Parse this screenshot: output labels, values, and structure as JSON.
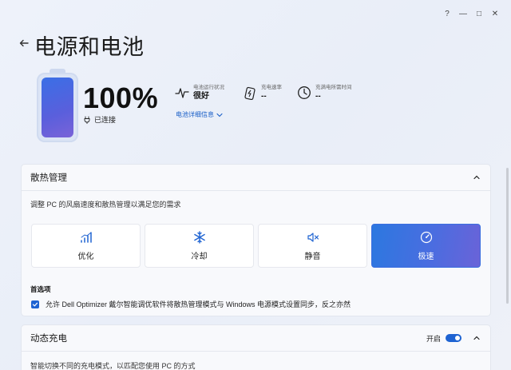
{
  "window": {
    "controls": {
      "help": "?",
      "minimize": "—",
      "maximize": "□",
      "close": "✕"
    }
  },
  "header": {
    "title": "电源和电池",
    "back_icon": "arrow-left-icon"
  },
  "battery": {
    "level_percent": 100,
    "percent_text": "100%",
    "status": "已连接",
    "fill_color": "#4a66e0"
  },
  "stats": [
    {
      "label": "电池运行状况",
      "value": "很好",
      "icon": "pulse-icon"
    },
    {
      "label": "充电速率",
      "value": "--",
      "icon": "battery-charging-icon"
    },
    {
      "label": "充满电所需时间",
      "value": "--",
      "icon": "clock-icon"
    }
  ],
  "detail_link": "电池详细信息",
  "thermal": {
    "title": "散热管理",
    "description": "调整 PC 的风扇速度和散热管理以满足您的需求",
    "modes": [
      {
        "label": "优化",
        "icon": "optimize-bars-icon",
        "active": false
      },
      {
        "label": "冷却",
        "icon": "snowflake-icon",
        "active": false
      },
      {
        "label": "静音",
        "icon": "mute-speaker-icon",
        "active": false
      },
      {
        "label": "极速",
        "icon": "speedometer-icon",
        "active": true
      }
    ],
    "preference_title": "首选项",
    "preference_text": "允许 Dell Optimizer 戴尔智能调优软件将散热管理模式与 Windows 电源模式设置同步，反之亦然",
    "preference_checked": true
  },
  "charging": {
    "title": "动态充电",
    "toggle_label": "开启",
    "toggle_on": true,
    "description": "智能切换不同的充电模式，以匹配您使用 PC 的方式"
  },
  "colors": {
    "accent": "#1e63d2",
    "active_mode_start": "#2c78e0",
    "active_mode_end": "#6a63d8"
  }
}
